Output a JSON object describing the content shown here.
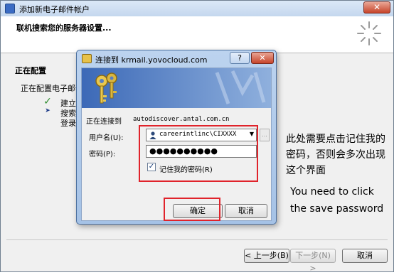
{
  "window": {
    "title": "添加新电子邮件帐户",
    "close_glyph": "✕",
    "header_title": "联机搜索您的服务器设置...",
    "section_title": "正在配置",
    "section_sub": "正在配置电子邮件",
    "steps": [
      {
        "mark": "✓",
        "label": "建立"
      },
      {
        "mark": "➤",
        "label": "搜索"
      },
      {
        "mark": "",
        "label": "登录"
      }
    ],
    "buttons": {
      "back": "< 上一步(B)",
      "next": "下一步(N) >",
      "cancel": "取消"
    }
  },
  "dialog": {
    "title": "连接到 krmail.yovocloud.com",
    "help_glyph": "?",
    "close_glyph": "✕",
    "connecting_label": "正在连接到",
    "connecting_host": "autodiscover.antal.com.cn",
    "username_label": "用户名(U):",
    "username_value": "careerintlinc\\CIXXXX",
    "combo_arrow": "▼",
    "browse_label": "...",
    "password_label": "密码(P):",
    "password_mask": "●●●●●●●●●●",
    "remember_checked_glyph": "✓",
    "remember_label": "记住我的密码(R)",
    "ok": "确定",
    "cancel": "取消"
  },
  "annotation": {
    "cn_lines": [
      "此处需要点击记住我的",
      "密码，否则会多次出现",
      "这个界面"
    ],
    "en_lines": [
      "You need to click",
      "the save password"
    ],
    "highlight_color": "#e0232b"
  },
  "icons": [
    "app-icon",
    "close-icon",
    "busy-spinner-icon",
    "keys-icon",
    "user-icon",
    "checkmark-icon",
    "arrow-icon"
  ]
}
